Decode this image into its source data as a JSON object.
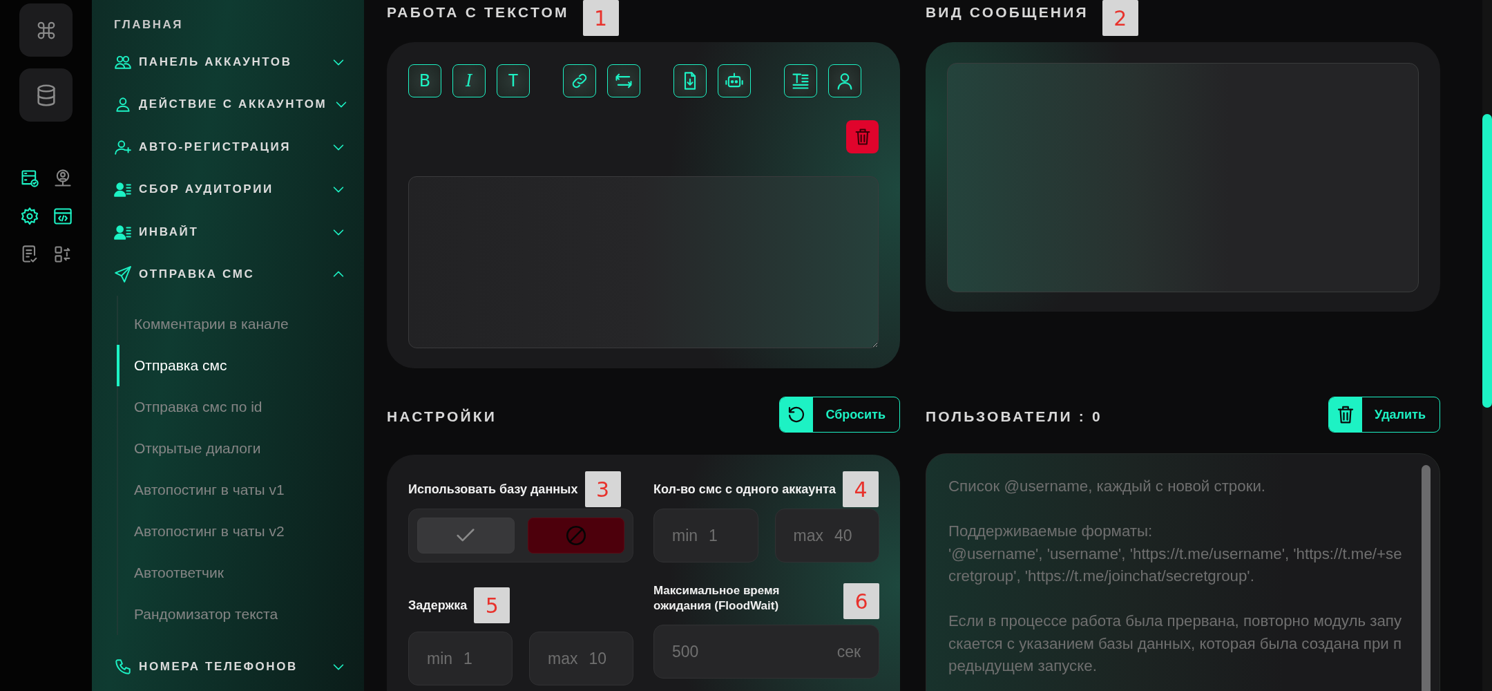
{
  "sidebar": {
    "title": "ГЛАВНАЯ",
    "items": [
      {
        "label": "ПАНЕЛЬ АККАУНТОВ",
        "expanded": false
      },
      {
        "label": "ДЕЙСТВИЕ С АККАУНТОМ",
        "expanded": false
      },
      {
        "label": "АВТО-РЕГИСТРАЦИЯ",
        "expanded": false
      },
      {
        "label": "СБОР АУДИТОРИИ",
        "expanded": false
      },
      {
        "label": "ИНВАЙТ",
        "expanded": false
      },
      {
        "label": "ОТПРАВКА СМС",
        "expanded": true,
        "children": [
          {
            "label": "Комментарии в канале",
            "selected": false
          },
          {
            "label": "Отправка смс",
            "selected": true
          },
          {
            "label": "Отправка смс по id",
            "selected": false
          },
          {
            "label": "Открытые диалоги",
            "selected": false
          },
          {
            "label": "Автопостинг в чаты v1",
            "selected": false
          },
          {
            "label": "Автопостинг в чаты v2",
            "selected": false
          },
          {
            "label": "Автоответчик",
            "selected": false
          },
          {
            "label": "Рандомизатор текста",
            "selected": false
          }
        ]
      },
      {
        "label": "НОМЕРА ТЕЛЕФОНОВ",
        "expanded": false
      }
    ]
  },
  "text_panel": {
    "title": "РАБОТА С ТЕКСТОМ",
    "annotation": "1",
    "format_buttons": [
      {
        "label": "B",
        "kind": "bold"
      },
      {
        "label": "I",
        "kind": "italic"
      },
      {
        "label": "T",
        "kind": "mono"
      }
    ]
  },
  "preview_panel": {
    "title": "ВИД СООБЩЕНИЯ",
    "annotation": "2"
  },
  "settings": {
    "title": "НАСТРОЙКИ",
    "reset_button": "Сбросить",
    "use_database": {
      "label": "Использовать базу данных",
      "annotation": "3",
      "options": [
        {
          "kind": "yes",
          "selected": false
        },
        {
          "kind": "no",
          "selected": true
        }
      ]
    },
    "sms_per_account": {
      "label": "Кол-во смс с одного аккаунта",
      "annotation": "4",
      "min": {
        "prefix": "min",
        "value": "1"
      },
      "max": {
        "prefix": "max",
        "value": "40"
      }
    },
    "delay": {
      "label": "Задержка",
      "annotation": "5",
      "min": {
        "prefix": "min",
        "value": "1"
      },
      "max": {
        "prefix": "max",
        "value": "10"
      }
    },
    "flood_wait": {
      "label": "Максимальное время ожидания (FloodWait)",
      "annotation": "6",
      "value": "500",
      "unit": "сек"
    }
  },
  "users": {
    "title": "ПОЛЬЗОВАТЕЛИ : 0",
    "delete_button": "Удалить",
    "placeholder": "Список @username, каждый с новой строки.\n\nПоддерживаемые форматы:\n'@username', 'username', 'https://t.me/username', 'https://t.me/+secretgroup', 'https://t.me/joinchat/secretgroup'.\n\nЕсли в процессе работа была прервана, повторно модуль запускается с указанием базы данных, которая была создана при предыдущем запуске."
  }
}
